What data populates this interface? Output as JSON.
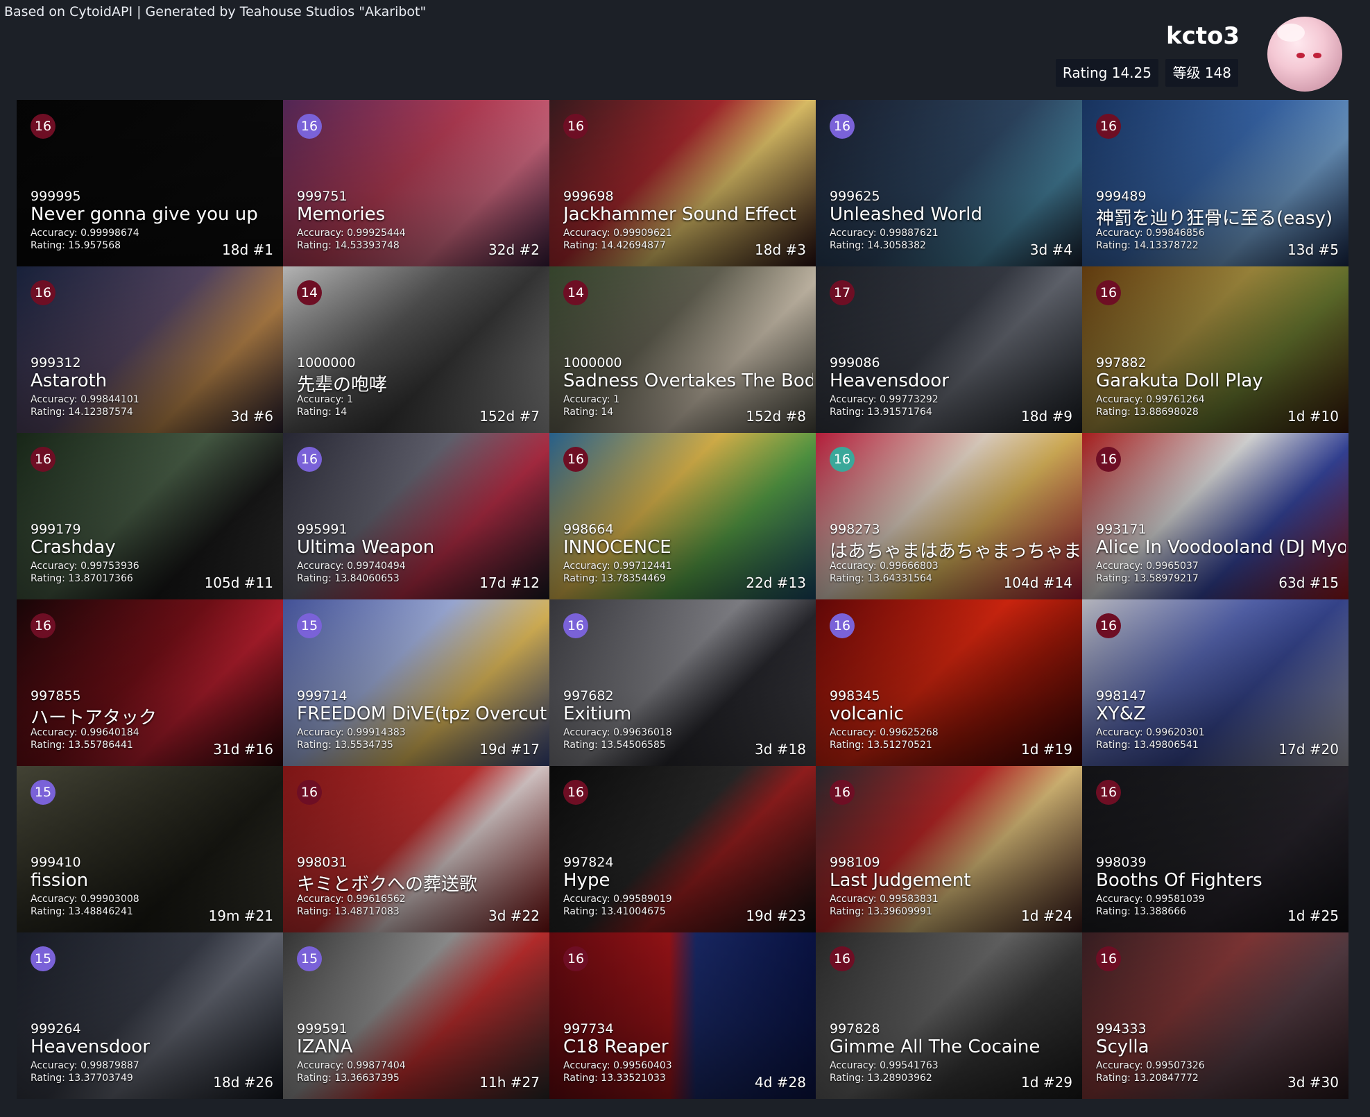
{
  "header": {
    "credit": "Based on CytoidAPI | Generated by Teahouse Studios \"Akaribot\"",
    "username": "kcto3",
    "rating_label": "Rating 14.25",
    "level_label": "等级 148"
  },
  "colors": {
    "background": "#1c2027",
    "diff_red": "#6e0e24",
    "diff_purple": "#7a62d8",
    "diff_teal": "#3aa89a"
  },
  "cards": [
    {
      "diff": "16",
      "diff_color": "#6e0e24",
      "score": "999995",
      "title": "Never gonna give you up",
      "accuracy": "Accuracy: 0.99998674",
      "rating": "Rating: 15.957568",
      "age": "18d #1",
      "bg": "linear-gradient(135deg,#050505,#0d0d0d)"
    },
    {
      "diff": "16",
      "diff_color": "#7a62d8",
      "score": "999751",
      "title": "Memories",
      "accuracy": "Accuracy: 0.99925444",
      "rating": "Rating: 14.53393748",
      "age": "32d #2",
      "bg": "linear-gradient(135deg,#5a2a5e,#c0405a 45%,#e0708a 70%,#3a1e3e)"
    },
    {
      "diff": "16",
      "diff_color": "#6e0e24",
      "score": "999698",
      "title": "Jackhammer Sound Effect",
      "accuracy": "Accuracy: 0.99909621",
      "rating": "Rating: 14.42694877",
      "age": "18d #3",
      "bg": "linear-gradient(135deg,#3a1c20,#b02a30 40%,#f0d070 60%,#2a1012)"
    },
    {
      "diff": "16",
      "diff_color": "#7a62d8",
      "score": "999625",
      "title": "Unleashed World",
      "accuracy": "Accuracy: 0.99887621",
      "rating": "Rating: 14.3058382",
      "age": "3d #4",
      "bg": "linear-gradient(135deg,#1a2030,#304a68 50%,#4a8aa8 75%,#1a2434)"
    },
    {
      "diff": "16",
      "diff_color": "#6e0e24",
      "score": "999489",
      "title": "神罰を辿り狂骨に至る(easy)",
      "accuracy": "Accuracy: 0.99846856",
      "rating": "Rating: 14.13378722",
      "age": "13d #5",
      "bg": "linear-gradient(135deg,#1a3868,#3a6ab0 45%,#78a8d8 70%,#1a2c50)"
    },
    {
      "diff": "16",
      "diff_color": "#6e0e24",
      "score": "999312",
      "title": "Astaroth",
      "accuracy": "Accuracy: 0.99844101",
      "rating": "Rating: 14.12387574",
      "age": "3d #6",
      "bg": "linear-gradient(135deg,#1a2440,#5a4a68 45%,#c89050 70%,#2a2030)"
    },
    {
      "diff": "14",
      "diff_color": "#6e0e24",
      "score": "1000000",
      "title": "先辈の咆哮",
      "accuracy": "Accuracy: 1",
      "rating": "Rating: 14",
      "age": "152d #7",
      "bg": "linear-gradient(135deg,#c8c8c8,#5a5a5a 40%,#3a3a3a 60%,#9a9a9a)"
    },
    {
      "diff": "14",
      "diff_color": "#6e0e24",
      "score": "1000000",
      "title": "Sadness Overtakes The Body",
      "accuracy": "Accuracy: 1",
      "rating": "Rating: 14",
      "age": "152d #8",
      "bg": "linear-gradient(135deg,#3a4a30,#6a6858 40%,#d8ccb8 65%,#4a4a40)"
    },
    {
      "diff": "17",
      "diff_color": "#6e0e24",
      "score": "999086",
      "title": "Heavensdoor",
      "accuracy": "Accuracy: 0.99773292",
      "rating": "Rating: 13.91571764",
      "age": "18d #9",
      "bg": "linear-gradient(135deg,#20242c,#3a3e48 45%,#6a6e78 60%,#1a1e24)"
    },
    {
      "diff": "16",
      "diff_color": "#6e0e24",
      "score": "997882",
      "title": "Garakuta Doll Play",
      "accuracy": "Accuracy: 0.99761264",
      "rating": "Rating: 13.88698028",
      "age": "1d #10",
      "bg": "linear-gradient(135deg,#6a4010,#a89040 40%,#6a7a30 65%,#3a1a0a)"
    },
    {
      "diff": "16",
      "diff_color": "#6e0e24",
      "score": "999179",
      "title": "Crashday",
      "accuracy": "Accuracy: 0.99753936",
      "rating": "Rating: 13.87017366",
      "age": "105d #11",
      "bg": "linear-gradient(135deg,#1a2a1a,#4a6048 45%,#1a1a1a 70%,#3a3a3a)"
    },
    {
      "diff": "16",
      "diff_color": "#7a62d8",
      "score": "995991",
      "title": "Ultima Weapon",
      "accuracy": "Accuracy: 0.99740494",
      "rating": "Rating: 13.84060653",
      "age": "17d #12",
      "bg": "linear-gradient(135deg,#2a2a38,#6a6a78 40%,#c0304a 65%,#1a1a24)"
    },
    {
      "diff": "16",
      "diff_color": "#6e0e24",
      "score": "998664",
      "title": "INNOCENCE",
      "accuracy": "Accuracy: 0.99712441",
      "rating": "Rating: 13.78354469",
      "age": "22d #13",
      "bg": "linear-gradient(135deg,#2a6a9a,#e8c050 40%,#5aa84a 65%,#1a4a6a)"
    },
    {
      "diff": "16",
      "diff_color": "#3aa89a",
      "score": "998273",
      "title": "はあちゃまはあちゃまっちゃま",
      "accuracy": "Accuracy: 0.99666803",
      "rating": "Rating: 13.64331564",
      "age": "104d #14",
      "bg": "linear-gradient(135deg,#c82040,#f0e0d0 40%,#e8c060 60%,#b01838)"
    },
    {
      "diff": "16",
      "diff_color": "#6e0e24",
      "score": "993171",
      "title": "Alice In Voodooland (DJ Myosuke",
      "accuracy": "Accuracy: 0.9965037",
      "rating": "Rating: 13.58979217",
      "age": "63d #15",
      "bg": "linear-gradient(135deg,#b82020,#e8e8e8 40%,#3a4aa8 65%,#a01818)"
    },
    {
      "diff": "16",
      "diff_color": "#6e0e24",
      "score": "997855",
      "title": "ハートアタック",
      "accuracy": "Accuracy: 0.99640184",
      "rating": "Rating: 13.55786441",
      "age": "31d #16",
      "bg": "linear-gradient(135deg,#1a0608,#7a1018 45%,#c02030 65%,#2a0608)"
    },
    {
      "diff": "15",
      "diff_color": "#7a62d8",
      "score": "999714",
      "title": "FREEDOM DiVE(tpz Overcute Remix)",
      "accuracy": "Accuracy: 0.99914383",
      "rating": "Rating: 13.5534735",
      "age": "19d #17",
      "bg": "linear-gradient(135deg,#4a5aa8,#a8b8e8 40%,#f0c860 65%,#3a4a88)"
    },
    {
      "diff": "16",
      "diff_color": "#7a62d8",
      "score": "997682",
      "title": "Exitium",
      "accuracy": "Accuracy: 0.99636018",
      "rating": "Rating: 13.54506585",
      "age": "3d #18",
      "bg": "linear-gradient(135deg,#3a3a40,#8a8a90 45%,#2a2a30 65%,#4a4a50)"
    },
    {
      "diff": "16",
      "diff_color": "#7a62d8",
      "score": "998345",
      "title": "volcanic",
      "accuracy": "Accuracy: 0.99625268",
      "rating": "Rating: 13.51270521",
      "age": "1d #19",
      "bg": "linear-gradient(135deg,#6a0808,#e02810 45%,#a01808 65%,#3a0404)"
    },
    {
      "diff": "16",
      "diff_color": "#6e0e24",
      "score": "998147",
      "title": "XY&Z",
      "accuracy": "Accuracy: 0.99620301",
      "rating": "Rating: 13.49806541",
      "age": "17d #20",
      "bg": "linear-gradient(135deg,#c8c8d0,#5a6ab8 40%,#3a4a98 60%,#a8a8b0)"
    },
    {
      "diff": "15",
      "diff_color": "#7a62d8",
      "score": "999410",
      "title": "fission",
      "accuracy": "Accuracy: 0.99903008",
      "rating": "Rating: 13.48846241",
      "age": "19m #21",
      "bg": "linear-gradient(135deg,#4a4a3a,#2a2a20 45%,#1a1a14 65%,#3a3a30)"
    },
    {
      "diff": "16",
      "diff_color": "#6e0e24",
      "score": "998031",
      "title": "キミとボクへの葬送歌",
      "accuracy": "Accuracy: 0.99616562",
      "rating": "Rating: 13.48717083",
      "age": "3d #22",
      "bg": "linear-gradient(135deg,#8a1818,#c83030 45%,#e8d8d8 60%,#7a1010)"
    },
    {
      "diff": "16",
      "diff_color": "#6e0e24",
      "score": "997824",
      "title": "Hype",
      "accuracy": "Accuracy: 0.99589019",
      "rating": "Rating: 13.41004675",
      "age": "19d #23",
      "bg": "linear-gradient(135deg,#0a0a0a,#2a2a2a 45%,#a02020 60%,#101010)"
    },
    {
      "diff": "16",
      "diff_color": "#6e0e24",
      "score": "998109",
      "title": "Last Judgement",
      "accuracy": "Accuracy: 0.99583831",
      "rating": "Rating: 13.39609991",
      "age": "1d #24",
      "bg": "linear-gradient(135deg,#2a2a30,#c02828 40%,#e8c880 60%,#3a1a1a)"
    },
    {
      "diff": "16",
      "diff_color": "#6e0e24",
      "score": "998039",
      "title": "Booths Of Fighters",
      "accuracy": "Accuracy: 0.99581039",
      "rating": "Rating: 13.388666",
      "age": "1d #25",
      "bg": "linear-gradient(135deg,#141418,#202024 45%,#28242c 65%,#101014)"
    },
    {
      "diff": "15",
      "diff_color": "#7a62d8",
      "score": "999264",
      "title": "Heavensdoor",
      "accuracy": "Accuracy: 0.99879887",
      "rating": "Rating: 13.37703749",
      "age": "18d #26",
      "bg": "linear-gradient(135deg,#1a1e28,#3a3e4a 45%,#6a6e7a 60%,#141820)"
    },
    {
      "diff": "15",
      "diff_color": "#7a62d8",
      "score": "999591",
      "title": "IZANA",
      "accuracy": "Accuracy: 0.99877404",
      "rating": "Rating: 13.36637395",
      "age": "11h #27",
      "bg": "linear-gradient(135deg,#3a3a3a,#9a9a9a 40%,#c83030 60%,#2a2a2a)"
    },
    {
      "diff": "16",
      "diff_color": "#6e0e24",
      "score": "997734",
      "title": "C18 Reaper",
      "accuracy": "Accuracy: 0.99560403",
      "rating": "Rating: 13.33521033",
      "age": "4d #28",
      "bg": "linear-gradient(90deg,#6a0a10,#a01418 45%,#1a2a6a 55%,#0a1448)"
    },
    {
      "diff": "16",
      "diff_color": "#6e0e24",
      "score": "997828",
      "title": "Gimme All The Cocaine",
      "accuracy": "Accuracy: 0.99541763",
      "rating": "Rating: 13.28903962",
      "age": "1d #29",
      "bg": "linear-gradient(135deg,#2a2a2a,#6a6a6a 45%,#3a3a3a 65%,#1a1a1a)"
    },
    {
      "diff": "16",
      "diff_color": "#6e0e24",
      "score": "994333",
      "title": "Scylla",
      "accuracy": "Accuracy: 0.99507326",
      "rating": "Rating: 13.20847772",
      "age": "3d #30",
      "bg": "linear-gradient(135deg,#3a2024,#8a3a3a 40%,#5a4048 65%,#2a1a1e)"
    }
  ]
}
